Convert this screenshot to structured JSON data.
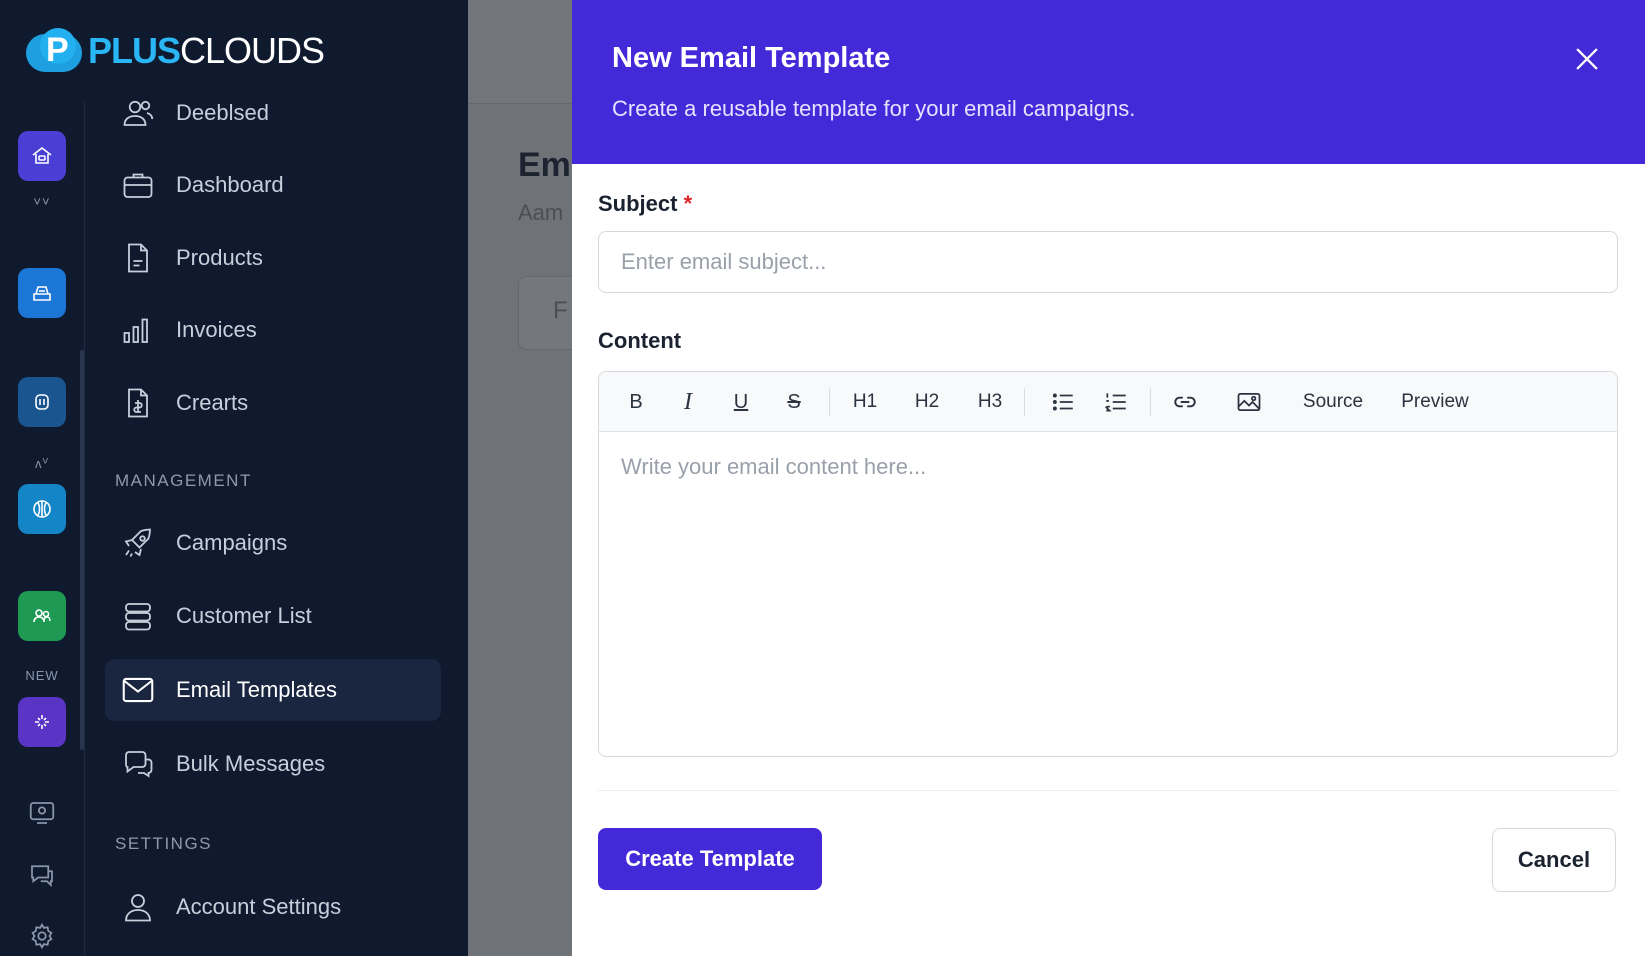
{
  "brand": {
    "logo_letter": "P",
    "logo_bold": "PLUS",
    "logo_light": "CLOUDS"
  },
  "rail": {
    "label_1": "˅˅",
    "label_2": "ʌⱽ",
    "new_label": "NEW"
  },
  "sidebar": {
    "items": [
      {
        "label": "Deeblsed",
        "icon": "users-icon"
      },
      {
        "label": "Dashboard",
        "icon": "briefcase-icon"
      },
      {
        "label": "Products",
        "icon": "document-icon"
      },
      {
        "label": "Invoices",
        "icon": "bar-chart-icon"
      },
      {
        "label": "Crearts",
        "icon": "file-dollar-icon"
      }
    ],
    "management_heading": "MANAGEMENT",
    "management_items": [
      {
        "label": "Campaigns",
        "icon": "rocket-icon"
      },
      {
        "label": "Customer List",
        "icon": "database-icon"
      },
      {
        "label": "Email Templates",
        "icon": "mail-icon",
        "active": true
      },
      {
        "label": "Bulk Messages",
        "icon": "chat-icon"
      }
    ],
    "settings_heading": "SETTINGS",
    "settings_items": [
      {
        "label": "Account Settings",
        "icon": "user-icon"
      }
    ]
  },
  "background_page": {
    "title": "Em",
    "subtitle": "Aam",
    "filter_text": "F"
  },
  "modal": {
    "title": "New Email Template",
    "description": "Create a reusable template for your email campaigns.",
    "subject_label": "Subject",
    "required_mark": "*",
    "subject_placeholder": "Enter email subject...",
    "subject_value": "",
    "content_label": "Content",
    "toolbar": {
      "bold": "B",
      "italic": "I",
      "underline": "U",
      "strike": "S",
      "h1": "H1",
      "h2": "H2",
      "h3": "H3",
      "source": "Source",
      "preview": "Preview"
    },
    "content_placeholder": "Write your email content here...",
    "create_label": "Create Template",
    "cancel_label": "Cancel"
  },
  "colors": {
    "sidebar_bg": "#0f1a2e",
    "modal_header": "#4329d8",
    "primary_button": "#4329d8",
    "required": "#e0242d"
  }
}
